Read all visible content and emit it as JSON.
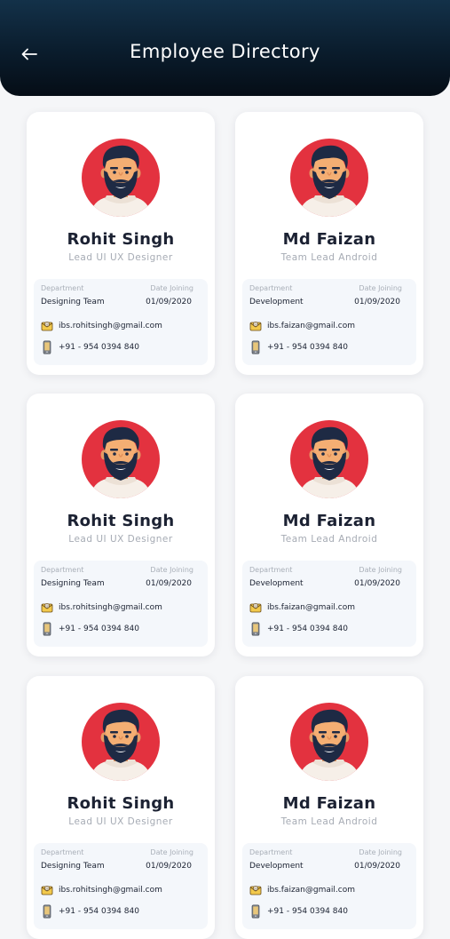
{
  "header": {
    "title": "Employee Directory",
    "back_icon": "arrow-left-icon"
  },
  "colors": {
    "header_dark": "#0a1c2c",
    "avatar_red": "#e3323f",
    "card_bg": "#ffffff",
    "info_bg": "#f4f7fb"
  },
  "labels": {
    "department": "Department",
    "date_joining": "Date Joining"
  },
  "employees": [
    {
      "name": "Rohit Singh",
      "role": "Lead UI UX Designer",
      "department": "Designing Team",
      "date_joining": "01/09/2020",
      "email": "ibs.rohitsingh@gmail.com",
      "phone": "+91 - 954 0394 840"
    },
    {
      "name": "Md Faizan",
      "role": "Team Lead Android",
      "department": "Development",
      "date_joining": "01/09/2020",
      "email": "ibs.faizan@gmail.com",
      "phone": "+91 - 954 0394 840"
    },
    {
      "name": "Rohit Singh",
      "role": "Lead UI UX Designer",
      "department": "Designing Team",
      "date_joining": "01/09/2020",
      "email": "ibs.rohitsingh@gmail.com",
      "phone": "+91 - 954 0394 840"
    },
    {
      "name": "Md Faizan",
      "role": "Team Lead Android",
      "department": "Development",
      "date_joining": "01/09/2020",
      "email": "ibs.faizan@gmail.com",
      "phone": "+91 - 954 0394 840"
    },
    {
      "name": "Rohit Singh",
      "role": "Lead UI UX Designer",
      "department": "Designing Team",
      "date_joining": "01/09/2020",
      "email": "ibs.rohitsingh@gmail.com",
      "phone": "+91 - 954 0394 840"
    },
    {
      "name": "Md Faizan",
      "role": "Team Lead Android",
      "department": "Development",
      "date_joining": "01/09/2020",
      "email": "ibs.faizan@gmail.com",
      "phone": "+91 - 954 0394 840"
    }
  ]
}
